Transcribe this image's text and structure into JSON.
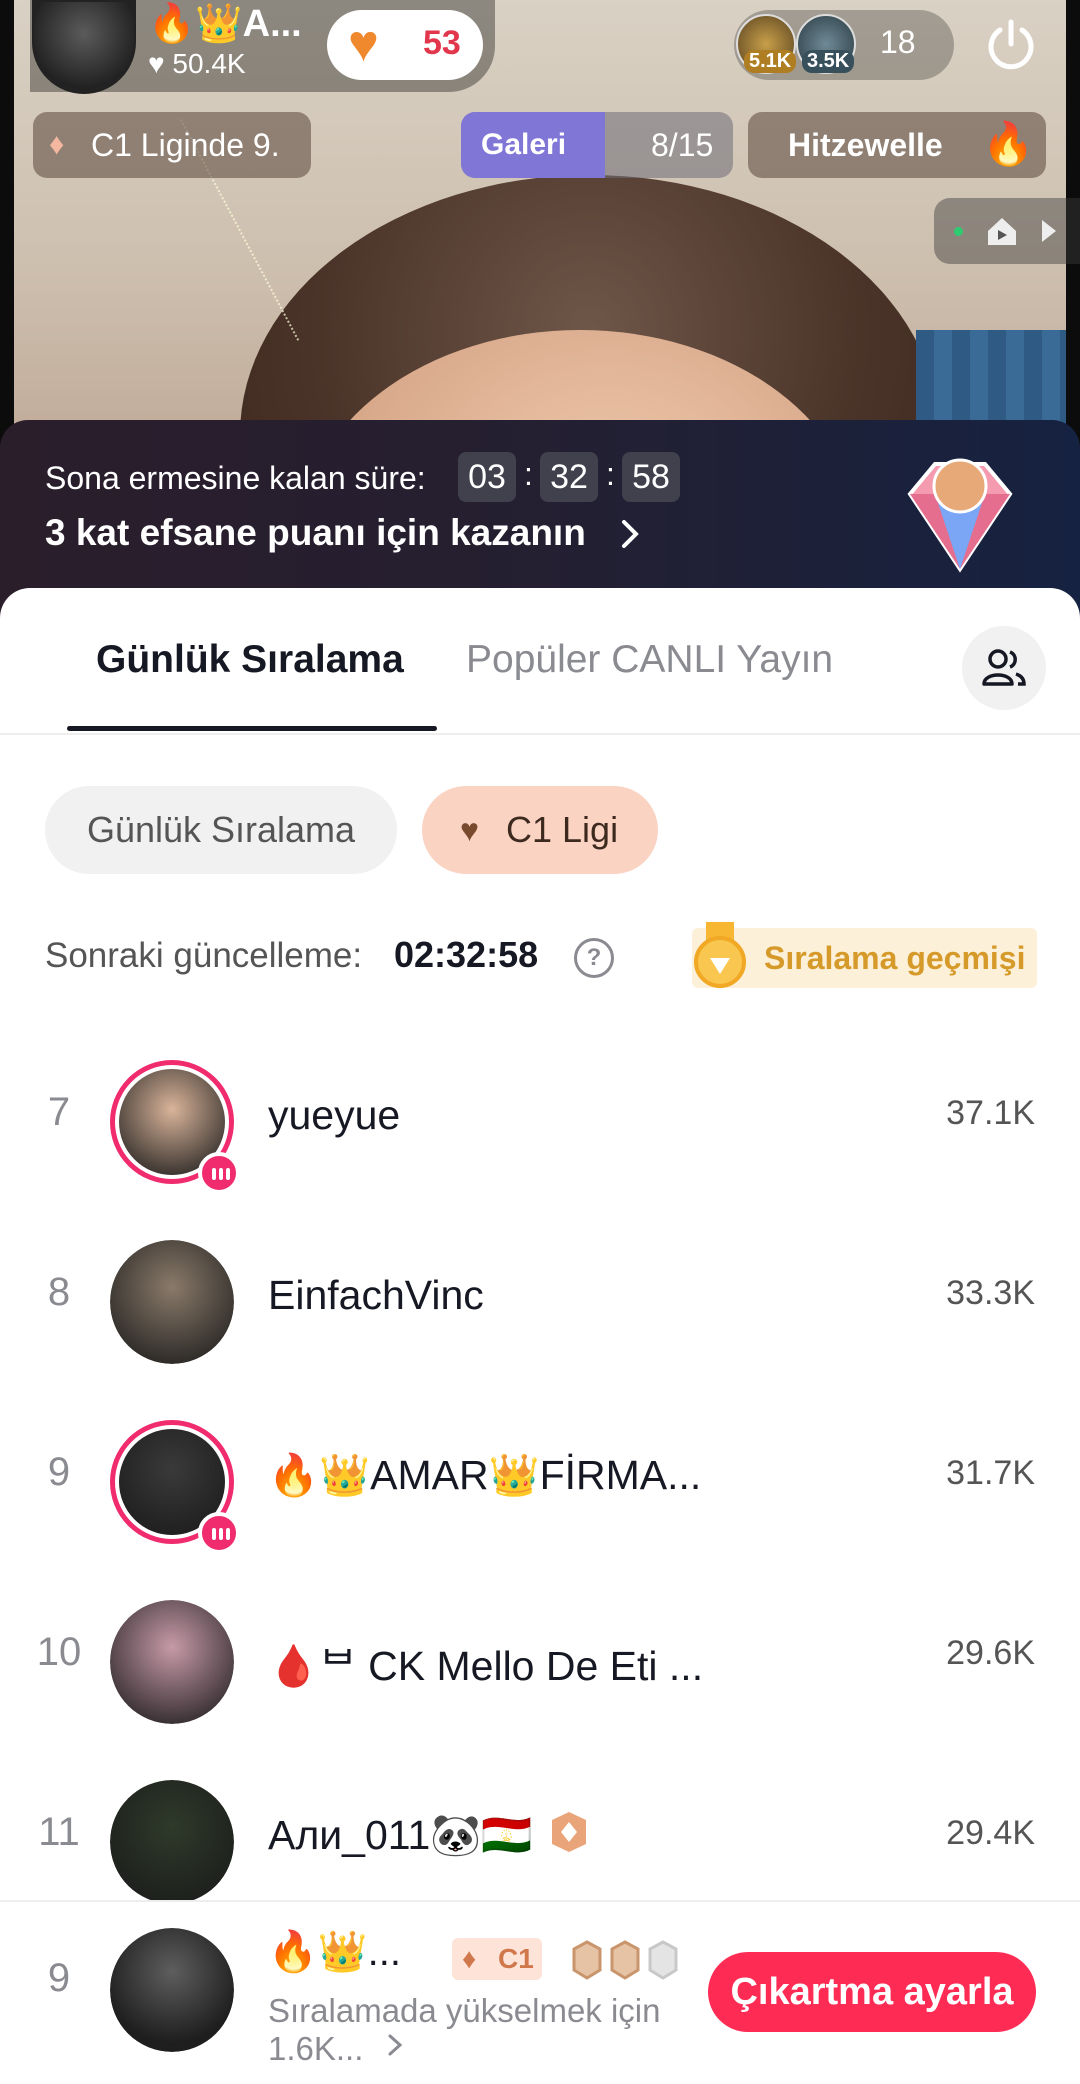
{
  "host": {
    "name": "🔥👑A...",
    "likes": "♥ 50.4K",
    "like_icon": "heart-icon",
    "gift_count": "53",
    "gift_icon": "orange-heart-icon"
  },
  "top_viewers": {
    "viewer1_score": "5.1K",
    "viewer2_score": "3.5K",
    "count": "18"
  },
  "badges": {
    "league": "C1 Liginde 9.",
    "gallery_label": "Galeri",
    "gallery_progress": "8/15",
    "gallery_progress_fraction": 0.53,
    "hitze": "Hitzewelle"
  },
  "banner": {
    "countdown_label": "Sona ermesine kalan süre:",
    "hours": "03",
    "minutes": "32",
    "seconds": "58",
    "cta": "3 kat efsane puanı için kazanın"
  },
  "tabs": {
    "daily": "Günlük Sıralama",
    "popular": "Popüler CANLI Yayın"
  },
  "segments": {
    "daily": "Günlük Sıralama",
    "league": "C1 Ligi"
  },
  "update": {
    "label": "Sonraki güncelleme:",
    "time": "02:32:58",
    "help": "?",
    "history": "Sıralama geçmişi"
  },
  "rankings": [
    {
      "rank": "7",
      "name": "yueyue",
      "score": "37.1K",
      "live": true,
      "color": "#d9b49a"
    },
    {
      "rank": "8",
      "name": "EinfachVinc",
      "score": "33.3K",
      "live": false,
      "color": "#8a7a6a"
    },
    {
      "rank": "9",
      "name": "🔥👑AMAR👑FİRMA...",
      "score": "31.7K",
      "live": true,
      "color": "#3a3a3a"
    },
    {
      "rank": "10",
      "name": "🩸ᄇ CK Mello De Eti ...",
      "score": "29.6K",
      "live": false,
      "color": "#c79aa8"
    },
    {
      "rank": "11",
      "name": "Али_011🐼🇹🇯",
      "score": "29.4K",
      "live": false,
      "color": "#2e3a2a"
    }
  ],
  "pinned": {
    "rank": "9",
    "name": "🔥👑...",
    "league_tag": "C1",
    "hint": "Sıralamada yükselmek için 1.6K...",
    "button": "Çıkartma ayarla"
  },
  "colors": {
    "accent": "#fe2c55",
    "live_ring": "#f02c6f",
    "league_bg": "#fbd3c3",
    "history_text": "#d69a2a"
  }
}
